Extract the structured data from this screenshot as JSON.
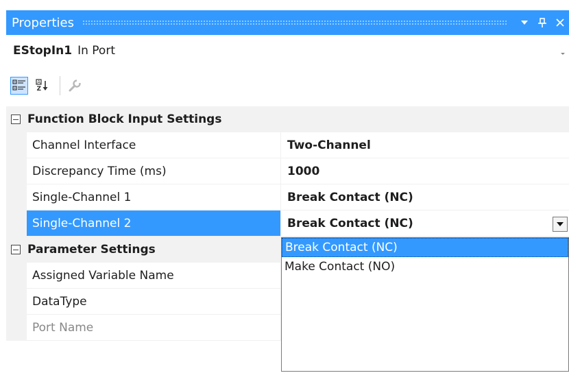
{
  "panel": {
    "title": "Properties",
    "pin_label": "I",
    "close_label": "✕"
  },
  "selector": {
    "object_name": "EStopIn1",
    "object_type": "In Port"
  },
  "toolbar": {
    "icons": [
      "categorized-icon",
      "alphabetical-sort-icon",
      "property-pages-icon"
    ]
  },
  "grid": {
    "categories": [
      {
        "label": "Function Block Input Settings",
        "properties": [
          {
            "name": "Channel Interface",
            "value": "Two-Channel"
          },
          {
            "name": "Discrepancy Time (ms)",
            "value": "1000"
          },
          {
            "name": "Single-Channel 1",
            "value": "Break Contact (NC)"
          },
          {
            "name": "Single-Channel 2",
            "value": "Break Contact (NC)"
          }
        ]
      },
      {
        "label": "Parameter Settings",
        "properties": [
          {
            "name": "Assigned Variable Name",
            "value": ""
          },
          {
            "name": "DataType",
            "value": ""
          },
          {
            "name": "Port Name",
            "value": ""
          }
        ]
      }
    ]
  },
  "dropdown": {
    "options": [
      "Break Contact (NC)",
      "Make Contact (NO)"
    ],
    "selected_index": 0
  },
  "colors": {
    "accent": "#3399ff",
    "category_background": "#f2f2f2"
  }
}
